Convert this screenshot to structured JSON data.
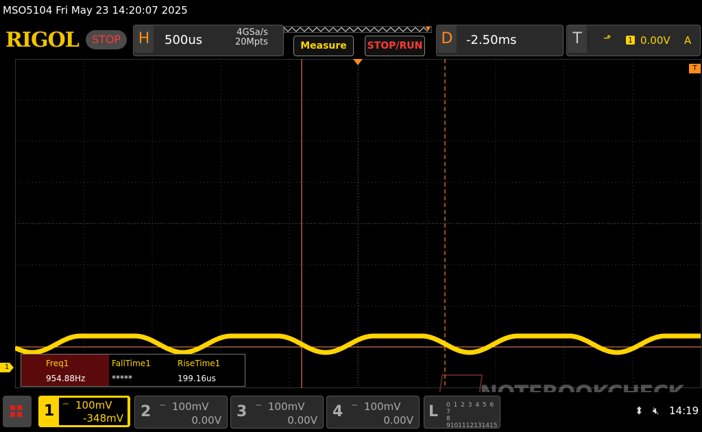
{
  "titlebar": {
    "text": "MSO5104  Fri May 23 14:20:07 2025"
  },
  "brand": {
    "logo": "RIGOL",
    "stop_label": "STOP"
  },
  "horizontal": {
    "letter": "H",
    "timebase": "500us",
    "sample_rate": "4GSa/s",
    "mem_depth": "20Mpts"
  },
  "buttons": {
    "measure": "Measure",
    "stop_run": "STOP/RUN"
  },
  "delay": {
    "letter": "D",
    "value": "-2.50ms"
  },
  "trigger": {
    "letter": "T",
    "source": "1",
    "level": "0.00V",
    "mode": "A",
    "icon": "rising-edge-icon"
  },
  "markers": {
    "channel1": "1",
    "trigger": "T"
  },
  "measurements": [
    {
      "label": "Freq1",
      "value": "954.88Hz"
    },
    {
      "label": "FallTime1",
      "value": "*****"
    },
    {
      "label": "RiseTime1",
      "value": "199.16us"
    }
  ],
  "channels": [
    {
      "num": "1",
      "scale": "100mV",
      "offset": "-348mV",
      "active": true
    },
    {
      "num": "2",
      "scale": "100mV",
      "offset": "0.00V",
      "active": false
    },
    {
      "num": "3",
      "scale": "100mV",
      "offset": "0.00V",
      "active": false
    },
    {
      "num": "4",
      "scale": "100mV",
      "offset": "0.00V",
      "active": false
    }
  ],
  "logic": {
    "letter": "L",
    "row1": "0 1 2 3 4 5 6 7",
    "row2": "8 9101112131415"
  },
  "status": {
    "time": "14:19"
  },
  "watermark": "NOTEBOOKCHECK",
  "colors": {
    "ch1": "#ffd400",
    "accent": "#ff8c1a",
    "stop": "#ff3b30",
    "grid": "#555555"
  }
}
